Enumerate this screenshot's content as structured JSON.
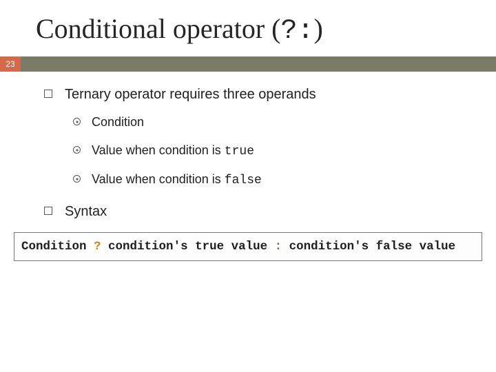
{
  "page_number": "23",
  "title": {
    "prefix": "Conditional operator (",
    "q": "?",
    "colon": ":",
    "suffix": ")"
  },
  "bullets": {
    "b1": "Ternary operator requires three operands",
    "sub": {
      "s1": "Condition",
      "s2_pre": "Value when condition is ",
      "s2_code": "true",
      "s3_pre": "Value when condition is ",
      "s3_code": "false"
    },
    "b2": "Syntax"
  },
  "syntax": {
    "p1": "Condition ",
    "q": "?",
    "p2": " condition's true value ",
    "colon": ":",
    "p3": " condition's false value"
  }
}
